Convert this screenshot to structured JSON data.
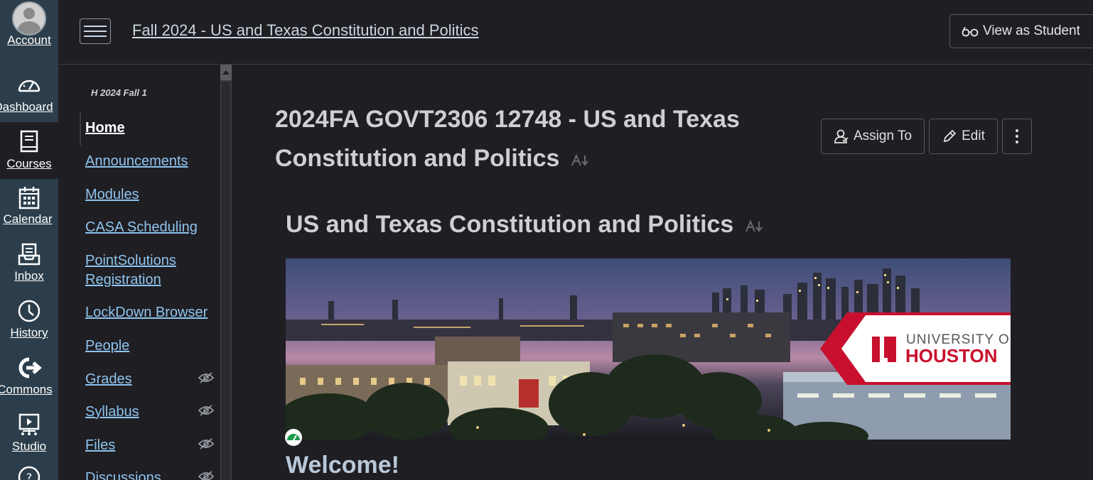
{
  "global_nav": {
    "items": [
      {
        "label": "Account",
        "icon": "avatar"
      },
      {
        "label": "Dashboard",
        "icon": "dashboard-icon"
      },
      {
        "label": "Courses",
        "icon": "courses-icon"
      },
      {
        "label": "Calendar",
        "icon": "calendar-icon"
      },
      {
        "label": "Inbox",
        "icon": "inbox-icon"
      },
      {
        "label": "History",
        "icon": "history-icon"
      },
      {
        "label": "Commons",
        "icon": "commons-icon"
      },
      {
        "label": "Studio",
        "icon": "studio-icon"
      },
      {
        "label": "",
        "icon": "help-icon"
      }
    ]
  },
  "header": {
    "breadcrumb": "Fall 2024 - US and Texas Constitution and Politics",
    "view_as_student": "View as Student"
  },
  "course_nav": {
    "term": "H 2024 Fall 1",
    "items": [
      {
        "label": "Home",
        "hidden": false
      },
      {
        "label": "Announcements",
        "hidden": false
      },
      {
        "label": "Modules",
        "hidden": false
      },
      {
        "label": "CASA Scheduling",
        "hidden": false
      },
      {
        "label": "PointSolutions Registration",
        "hidden": false
      },
      {
        "label": "LockDown Browser",
        "hidden": false
      },
      {
        "label": "People",
        "hidden": false
      },
      {
        "label": "Grades",
        "hidden": true
      },
      {
        "label": "Syllabus",
        "hidden": true
      },
      {
        "label": "Files",
        "hidden": true
      },
      {
        "label": "Discussions",
        "hidden": true
      }
    ]
  },
  "main": {
    "course_title": "2024FA GOVT2306 12748 - US and Texas Constitution and Politics",
    "assign_to": "Assign To",
    "edit": "Edit",
    "sub_title": "US and Texas Constitution and Politics",
    "banner": {
      "logo_line1": "UNIVERSITY OF",
      "logo_line2": "HOUSTON"
    },
    "welcome": "Welcome!"
  },
  "colors": {
    "nav_bg": "#2c3e4b",
    "page_bg": "#1f1e23",
    "link": "#8ec4ee",
    "uh_red": "#c8102e"
  }
}
